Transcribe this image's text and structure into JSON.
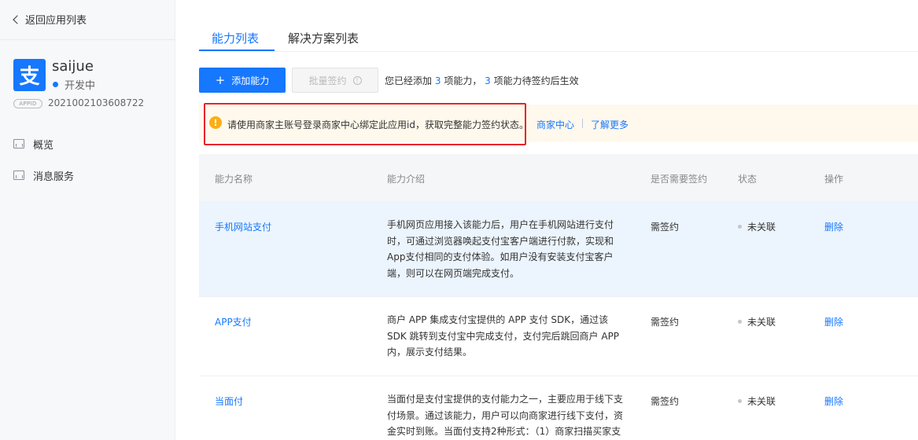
{
  "sidebar": {
    "back_label": "返回应用列表",
    "app_logo_glyph": "支",
    "app_name": "saijue",
    "app_status": "开发中",
    "appid_badge": "APPID",
    "appid_value": "2021002103608722",
    "nav": [
      {
        "label": "概览",
        "icon": "overview-icon"
      },
      {
        "label": "消息服务",
        "icon": "message-service-icon"
      }
    ]
  },
  "tabs": [
    {
      "label": "能力列表",
      "active": true
    },
    {
      "label": "解决方案列表",
      "active": false
    }
  ],
  "toolbar": {
    "add_label": "添加能力",
    "batch_label": "批量签约",
    "summary_prefix": "您已经添加",
    "summary_count1": "3",
    "summary_mid": "项能力，",
    "summary_count2": "3",
    "summary_suffix": "项能力待签约后生效"
  },
  "banner": {
    "icon_glyph": "!",
    "text": "请使用商家主账号登录商家中心绑定此应用id，获取完整能力签约状态。",
    "link1": "商家中心",
    "link2": "了解更多"
  },
  "table": {
    "headers": [
      "能力名称",
      "能力介绍",
      "是否需要签约",
      "状态",
      "操作"
    ],
    "rows": [
      {
        "name": "手机网站支付",
        "description": "手机网页应用接入该能力后，用户在手机网站进行支付时，可通过浏览器唤起支付宝客户端进行付款，实现和App支付相同的支付体验。如用户没有安装支付宝客户端，则可以在网页端完成支付。",
        "sign": "需签约",
        "status": "未关联",
        "action": "删除"
      },
      {
        "name": "APP支付",
        "description": "商户 APP 集成支付宝提供的 APP 支付 SDK，通过该 SDK 跳转到支付宝中完成支付，支付完后跳回商户 APP 内，展示支付结果。",
        "sign": "需签约",
        "status": "未关联",
        "action": "删除"
      },
      {
        "name": "当面付",
        "description": "当面付是支付宝提供的支付能力之一，主要应用于线下支付场景。通过该能力，用户可以向商家进行线下支付，资金实时到账。当面付支持2种形式：（1）商家扫描买家支",
        "sign": "需签约",
        "status": "未关联",
        "action": "删除"
      }
    ]
  },
  "colors": {
    "primary": "#1677ff",
    "highlight_box": "#e8242a",
    "warning": "#fcae15",
    "banner_bg": "#fff8ec",
    "row_selected_bg": "#ecf5fd"
  }
}
